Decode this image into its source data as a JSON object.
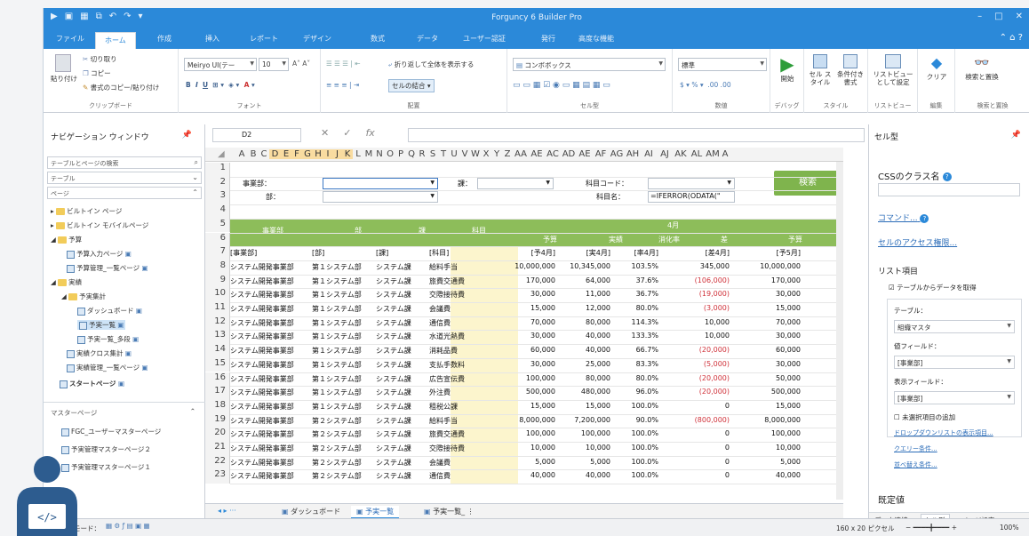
{
  "window": {
    "title": "Forguncy 6 Builder Pro"
  },
  "ribbon_tabs": [
    "ファイル",
    "ホーム",
    "作成",
    "挿入",
    "レポート",
    "デザイン",
    "数式",
    "データ",
    "ユーザー認証",
    "発行",
    "高度な機能"
  ],
  "ribbon": {
    "clipboard": {
      "label": "クリップボード",
      "paste": "貼り付け",
      "cut": "切り取り",
      "copy": "コピー",
      "format_copy": "書式のコピー/貼り付け"
    },
    "font": {
      "label": "フォント",
      "family": "Meiryo UI(テー",
      "size": "10"
    },
    "align": {
      "label": "配置",
      "wrap": "折り返して全体を表示する",
      "merge": "セルの結合"
    },
    "celltype": {
      "label": "セル型",
      "combo": "コンボボックス"
    },
    "number": {
      "label": "数値",
      "format": "標準",
      "percent": "%",
      "dec": ".00 .00"
    },
    "debug": {
      "label": "デバッグ",
      "start": "開始"
    },
    "style": {
      "label": "スタイル",
      "cell_style": "セル スタイル",
      "cond": "条件付き 書式"
    },
    "listview": {
      "label": "リストビュー",
      "btn": "リストビュー として設定"
    },
    "edit": {
      "label": "編集",
      "clear": "クリア"
    },
    "find": {
      "label": "検索と置換",
      "btn": "検索と置換"
    }
  },
  "formula": {
    "cellref": "D2"
  },
  "nav": {
    "title": "ナビゲーション ウィンドウ",
    "search_placeholder": "テーブルとページの検索",
    "table_label": "テーブル",
    "page_label": "ページ",
    "items": [
      "ビルトイン ページ",
      "ビルトイン モバイルページ",
      "予算",
      "予算入力ページ",
      "予算管理_一覧ページ",
      "実績",
      "予実集計",
      "ダッシュボード",
      "予実一覧",
      "予実一覧_多段",
      "実績クロス集計",
      "実績管理_一覧ページ",
      "スタートページ"
    ],
    "master_label": "マスターページ",
    "masters": [
      "FGC_ユーザーマスターページ",
      "予実管理マスターページ２",
      "予実管理マスターページ１"
    ]
  },
  "sheet": {
    "columns": [
      "A",
      "B",
      "C",
      "D",
      "E",
      "F",
      "G",
      "H",
      "I",
      "J",
      "K",
      "L",
      "M",
      "N",
      "O",
      "P",
      "Q",
      "R",
      "S",
      "T",
      "U",
      "V",
      "W",
      "X",
      "Y",
      "Z",
      "AA",
      "AE",
      "AC",
      "AD",
      "AE",
      "AF",
      "AG",
      "AH",
      "AI",
      "AJ",
      "AK",
      "AL",
      "AM",
      "A"
    ],
    "filters": {
      "dept": "事業部：",
      "bu": "部：",
      "ka": "課：",
      "kamoku_code": "科目コード：",
      "kamoku_name": "科目名：",
      "formula_text": "=IFERROR(ODATA(\"",
      "search_btn": "検索"
    },
    "headers": {
      "jigyobu": "事業部",
      "bu": "部",
      "ka": "課",
      "kamoku": "科目",
      "month": "4月",
      "yosan": "予算",
      "jisseki": "実績",
      "shoka": "消化率",
      "sa": "差",
      "yosan2": "予算"
    },
    "fields": [
      "[事業部]",
      "[部]",
      "[課]",
      "[科目]",
      "[予4月]",
      "[実4月]",
      "[率4月]",
      "[差4月]",
      "[予5月]"
    ],
    "rows": [
      [
        "システム開発事業部",
        "第１システム部",
        "システム課",
        "給料手当",
        "10,000,000",
        "10,345,000",
        "103.5%",
        "345,000",
        "10,000,000"
      ],
      [
        "システム開発事業部",
        "第１システム部",
        "システム課",
        "旅費交通費",
        "170,000",
        "64,000",
        "37.6%",
        "(106,000)",
        "170,000"
      ],
      [
        "システム開発事業部",
        "第１システム部",
        "システム課",
        "交際接待費",
        "30,000",
        "11,000",
        "36.7%",
        "(19,000)",
        "30,000"
      ],
      [
        "システム開発事業部",
        "第１システム部",
        "システム課",
        "会議費",
        "15,000",
        "12,000",
        "80.0%",
        "(3,000)",
        "15,000"
      ],
      [
        "システム開発事業部",
        "第１システム部",
        "システム課",
        "通信費",
        "70,000",
        "80,000",
        "114.3%",
        "10,000",
        "70,000"
      ],
      [
        "システム開発事業部",
        "第１システム部",
        "システム課",
        "水道光熱費",
        "30,000",
        "40,000",
        "133.3%",
        "10,000",
        "30,000"
      ],
      [
        "システム開発事業部",
        "第１システム部",
        "システム課",
        "消耗品費",
        "60,000",
        "40,000",
        "66.7%",
        "(20,000)",
        "60,000"
      ],
      [
        "システム開発事業部",
        "第１システム部",
        "システム課",
        "支払手数料",
        "30,000",
        "25,000",
        "83.3%",
        "(5,000)",
        "30,000"
      ],
      [
        "システム開発事業部",
        "第１システム部",
        "システム課",
        "広告宣伝費",
        "100,000",
        "80,000",
        "80.0%",
        "(20,000)",
        "50,000"
      ],
      [
        "システム開発事業部",
        "第１システム部",
        "システム課",
        "外注費",
        "500,000",
        "480,000",
        "96.0%",
        "(20,000)",
        "500,000"
      ],
      [
        "システム開発事業部",
        "第１システム部",
        "システム課",
        "租税公課",
        "15,000",
        "15,000",
        "100.0%",
        "0",
        "15,000"
      ],
      [
        "システム開発事業部",
        "第２システム部",
        "システム課",
        "給料手当",
        "8,000,000",
        "7,200,000",
        "90.0%",
        "(800,000)",
        "8,000,000"
      ],
      [
        "システム開発事業部",
        "第２システム部",
        "システム課",
        "旅費交通費",
        "100,000",
        "100,000",
        "100.0%",
        "0",
        "100,000"
      ],
      [
        "システム開発事業部",
        "第２システム部",
        "システム課",
        "交際接待費",
        "10,000",
        "10,000",
        "100.0%",
        "0",
        "10,000"
      ],
      [
        "システム開発事業部",
        "第２システム部",
        "システム課",
        "会議費",
        "5,000",
        "5,000",
        "100.0%",
        "0",
        "5,000"
      ],
      [
        "システム開発事業部",
        "第２システム部",
        "システム課",
        "通信費",
        "40,000",
        "40,000",
        "100.0%",
        "0",
        "40,000"
      ]
    ],
    "row_numbers": [
      "1",
      "2",
      "3",
      "4",
      "5",
      "6",
      "7",
      "8",
      "9",
      "10",
      "11",
      "12",
      "13",
      "14",
      "15",
      "16",
      "17",
      "18",
      "19",
      "20",
      "21",
      "22",
      "23"
    ]
  },
  "sheet_tabs": [
    "ダッシュボード",
    "予実一覧",
    "予実一覧_"
  ],
  "rightpanel": {
    "title": "セル型",
    "css_label": "CSSのクラス名",
    "command": "コマンド...",
    "access": "セルのアクセス権限...",
    "list_label": "リスト項目",
    "from_table": "テーブルからデータを取得",
    "table": "テーブル：",
    "table_val": "組織マスタ",
    "value_field": "値フィールド：",
    "value_field_val": "[事業部]",
    "display_field": "表示フィールド：",
    "display_field_val": "[事業部]",
    "unselected": "未選択項目の追加",
    "dropdown_link": "ドロップダウンリストの表示項目...",
    "query": "クエリー条件...",
    "sort": "並べ替え条件...",
    "default_label": "既定値",
    "tabs": [
      "データ連結",
      "セル型",
      "ページ設定"
    ]
  },
  "status": {
    "mode": "モード：",
    "size": "160 x 20 ピクセル",
    "zoom": "100%"
  },
  "colors": {
    "accent": "#2b89d9",
    "header_green": "#8dbd5a",
    "highlight": "#f9dca0",
    "negative": "#d0323a"
  }
}
